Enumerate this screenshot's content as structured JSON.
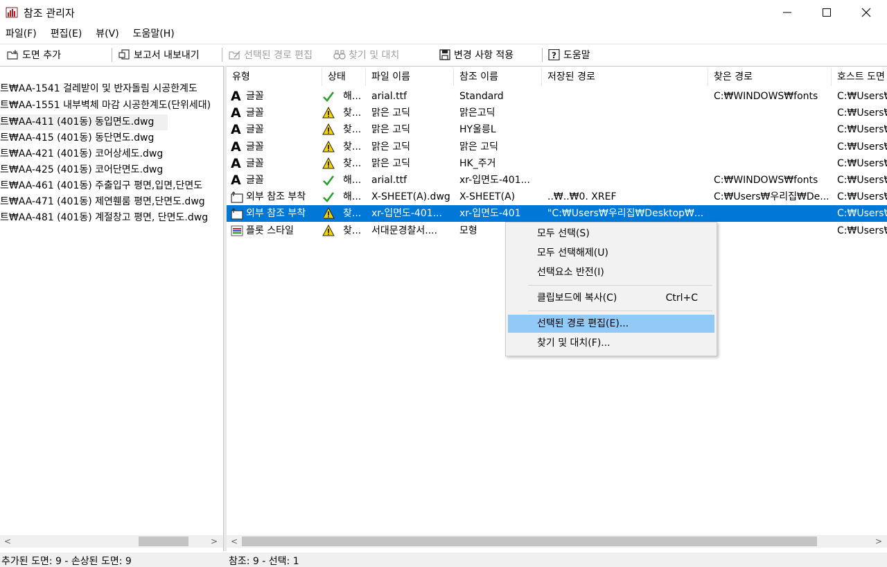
{
  "window": {
    "title": "참조 관리자",
    "controls": {
      "minimize": "—",
      "maximize": "☐",
      "close": "✕"
    }
  },
  "menu": [
    "파일(F)",
    "편집(E)",
    "뷰(V)",
    "도움말(H)"
  ],
  "toolbar": {
    "add_drawing": "도면 추가",
    "export_report": "보고서 내보내기",
    "edit_selected_path": "선택된 경로 편집",
    "find_replace": "찾기 및 대치",
    "apply_changes": "변경 사항 적용",
    "help": "도움말"
  },
  "tree": [
    "트₩AA-1541 걸레받이 및 반자돌림 시공한계도",
    "트₩AA-1551 내부벽체 마감 시공한계도(단위세대)",
    "트₩AA-411 (401동) 동입면도.dwg",
    "트₩AA-415 (401동) 동단면도.dwg",
    "트₩AA-421 (401동) 코어상세도.dwg",
    "트₩AA-425 (401동) 코어단면도.dwg",
    "트₩AA-461 (401동) 주출입구 평면,입면,단면도",
    "트₩AA-471 (401동) 제연휀룸 평면,단면도.dwg",
    "트₩AA-481 (401동) 계절창고 평면, 단면도.dwg"
  ],
  "columns": [
    "유형",
    "상태",
    "파일 이름",
    "참조 이름",
    "저장된 경로",
    "찾은 경로",
    "호스트 도면"
  ],
  "rows": [
    {
      "icon": "font-icon",
      "type": "글꼴",
      "status_icon": "check",
      "status": "해...",
      "file": "arial.ttf",
      "ref": "Standard",
      "saved": "",
      "found": "C:₩WINDOWS₩fonts",
      "host": "C:₩Users₩"
    },
    {
      "icon": "font-icon",
      "type": "글꼴",
      "status_icon": "warn",
      "status": "찾...",
      "file": "맑은 고딕",
      "ref": "맑은고딕",
      "saved": "",
      "found": "",
      "host": "C:₩Users₩"
    },
    {
      "icon": "font-icon",
      "type": "글꼴",
      "status_icon": "warn",
      "status": "찾...",
      "file": "맑은 고딕",
      "ref": "HY울릉L",
      "saved": "",
      "found": "",
      "host": "C:₩Users₩"
    },
    {
      "icon": "font-icon",
      "type": "글꼴",
      "status_icon": "warn",
      "status": "찾...",
      "file": "맑은 고딕",
      "ref": "맑은 고딕",
      "saved": "",
      "found": "",
      "host": "C:₩Users₩"
    },
    {
      "icon": "font-icon",
      "type": "글꼴",
      "status_icon": "warn",
      "status": "찾...",
      "file": "맑은 고딕",
      "ref": "HK_주거",
      "saved": "",
      "found": "",
      "host": "C:₩Users₩"
    },
    {
      "icon": "font-icon",
      "type": "글꼴",
      "status_icon": "check",
      "status": "해...",
      "file": "arial.ttf",
      "ref": "xr-입면도-401...",
      "saved": "",
      "found": "C:₩WINDOWS₩fonts",
      "host": "C:₩Users₩"
    },
    {
      "icon": "xref-icon",
      "type": "외부 참조 부착",
      "status_icon": "check",
      "status": "해...",
      "file": "X-SHEET(A).dwg",
      "ref": "X-SHEET(A)",
      "saved": "..₩..₩0. XREF",
      "found": "C:₩Users₩우리집₩De...",
      "host": "C:₩Users₩"
    },
    {
      "icon": "xref-icon",
      "type": "외부 참조 부착",
      "status_icon": "warn",
      "status": "찾...",
      "file": "xr-입면도-401...",
      "ref": "xr-입면도-401",
      "saved": "\"C:₩Users₩우리집₩Desktop₩...",
      "found": "",
      "host": "C:₩Users₩",
      "selected": true
    },
    {
      "icon": "plotstyle-icon",
      "type": "플롯 스타일",
      "status_icon": "warn",
      "status": "찾...",
      "file": "서대문경찰서....",
      "ref": "모형",
      "saved": "",
      "found": "",
      "host": "C:₩Users₩"
    }
  ],
  "context_menu": {
    "select_all": "모두 선택(S)",
    "deselect_all": "모두 선택해제(U)",
    "invert_selection": "선택요소 반전(I)",
    "copy_clipboard": "클립보드에 복사(C)",
    "copy_shortcut": "Ctrl+C",
    "edit_selected_path": "선택된 경로 편집(E)...",
    "find_replace": "찾기 및 대치(F)..."
  },
  "status": {
    "left": "추가된 도면: 9  -  손상된 도면: 9",
    "right": "참조: 9  -  선택: 1"
  },
  "colors": {
    "selection": "#0078d7",
    "menu_highlight": "#91c9f7",
    "check": "#2aa12a",
    "warn": "#f5d300"
  }
}
